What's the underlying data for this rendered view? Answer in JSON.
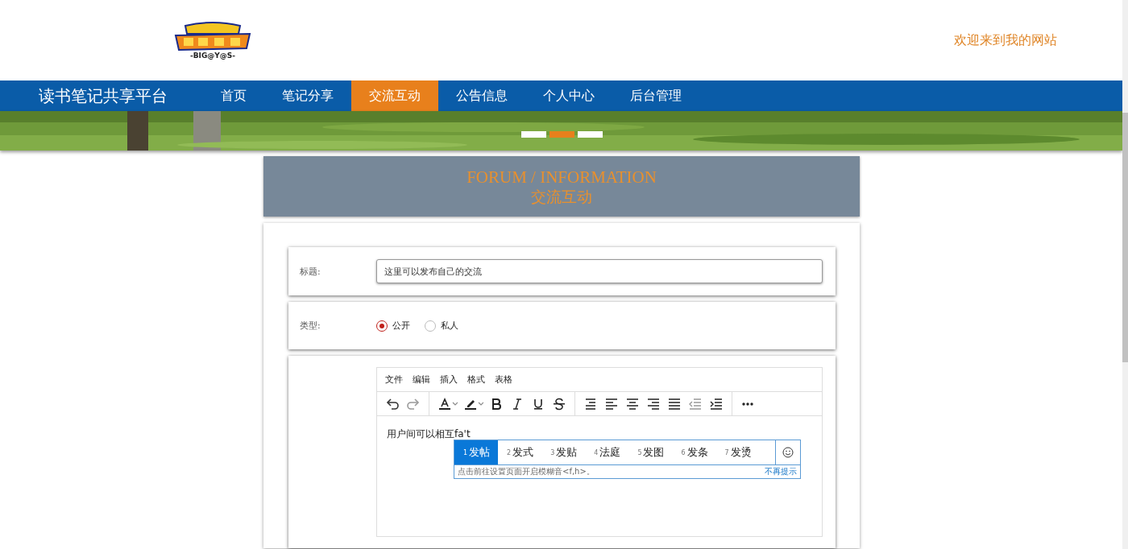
{
  "header": {
    "logo_caption": "-BIG@Y@S-",
    "welcome": "欢迎来到我的网站"
  },
  "nav": {
    "brand": "读书笔记共享平台",
    "items": [
      {
        "label": "首页",
        "selected": false
      },
      {
        "label": "笔记分享",
        "selected": false
      },
      {
        "label": "交流互动",
        "selected": true
      },
      {
        "label": "公告信息",
        "selected": false
      },
      {
        "label": "个人中心",
        "selected": false
      },
      {
        "label": "后台管理",
        "selected": false
      }
    ]
  },
  "banner": {
    "kind": "picture",
    "dots": [
      {
        "selected": false
      },
      {
        "selected": true
      },
      {
        "selected": false
      }
    ]
  },
  "section_heading": {
    "title": "FORUM / INFORMATION",
    "subtitle": "交流互动"
  },
  "form": {
    "title_field": {
      "label": "标题:",
      "placeholder": "这里可以发布自己的交流"
    },
    "type_field": {
      "label": "类型:",
      "options": [
        {
          "label": "公开",
          "selected": true
        },
        {
          "label": "私人",
          "selected": false
        }
      ]
    },
    "editor": {
      "menu": [
        "文件",
        "编辑",
        "插入",
        "格式",
        "表格"
      ],
      "toolbar_groups": [
        {
          "tools": [
            {
              "kind": "undo"
            },
            {
              "kind": "redo"
            }
          ]
        },
        {
          "tools": [
            {
              "kind": "font-color"
            },
            {
              "kind": "highlight"
            },
            {
              "kind": "bold"
            },
            {
              "kind": "italic"
            },
            {
              "kind": "underline"
            },
            {
              "kind": "strike"
            }
          ]
        },
        {
          "tools": [
            {
              "kind": "line-height"
            },
            {
              "kind": "align-left"
            },
            {
              "kind": "align-center"
            },
            {
              "kind": "align-right"
            },
            {
              "kind": "justify"
            },
            {
              "kind": "outdent"
            },
            {
              "kind": "indent"
            }
          ]
        },
        {
          "tools": [
            {
              "kind": "more"
            }
          ]
        }
      ],
      "text": "用户间可以相互",
      "composing": "fa't"
    },
    "ime": {
      "candidates": [
        {
          "number": "1",
          "text": "发帖",
          "selected": true
        },
        {
          "number": "2",
          "text": "发式",
          "selected": false
        },
        {
          "number": "3",
          "text": "发贴",
          "selected": false
        },
        {
          "number": "4",
          "text": "法庭",
          "selected": false
        },
        {
          "number": "5",
          "text": "发图",
          "selected": false
        },
        {
          "number": "6",
          "text": "发条",
          "selected": false
        },
        {
          "number": "7",
          "text": "发烫",
          "selected": false
        }
      ],
      "hint": "点击前往设置页面开启模糊音<f,h>。",
      "dismiss": "不再提示"
    }
  }
}
